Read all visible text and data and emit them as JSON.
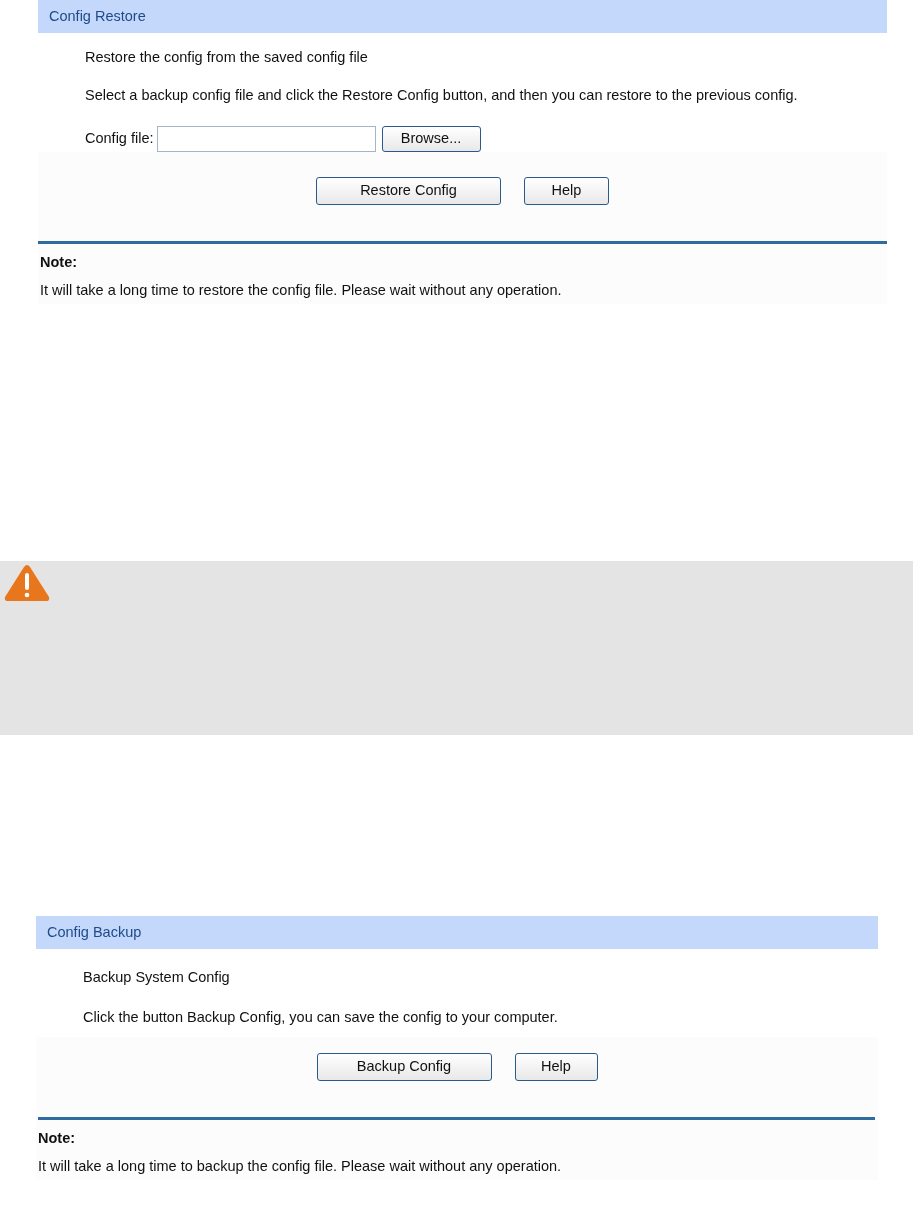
{
  "panels": [
    {
      "title": "Config Restore",
      "lines": [
        "Restore the config from the saved config file",
        "Select a backup config file and click the Restore Config button, and then you can restore to the previous config."
      ],
      "file_field": {
        "label": "Config file:",
        "browse": "Browse..."
      },
      "buttons": [
        "Restore Config",
        "Help"
      ],
      "note_title": "Note:",
      "note": "It will take a long time to restore the config file. Please wait without any operation."
    },
    {
      "title": "Config Backup",
      "lines": [
        "Backup System Config",
        "Click the button Backup Config, you can save the config to your computer."
      ],
      "buttons": [
        "Backup Config",
        "Help"
      ],
      "note_title": "Note:",
      "note": "It will take a long time to backup the config file. Please wait without any operation."
    }
  ]
}
